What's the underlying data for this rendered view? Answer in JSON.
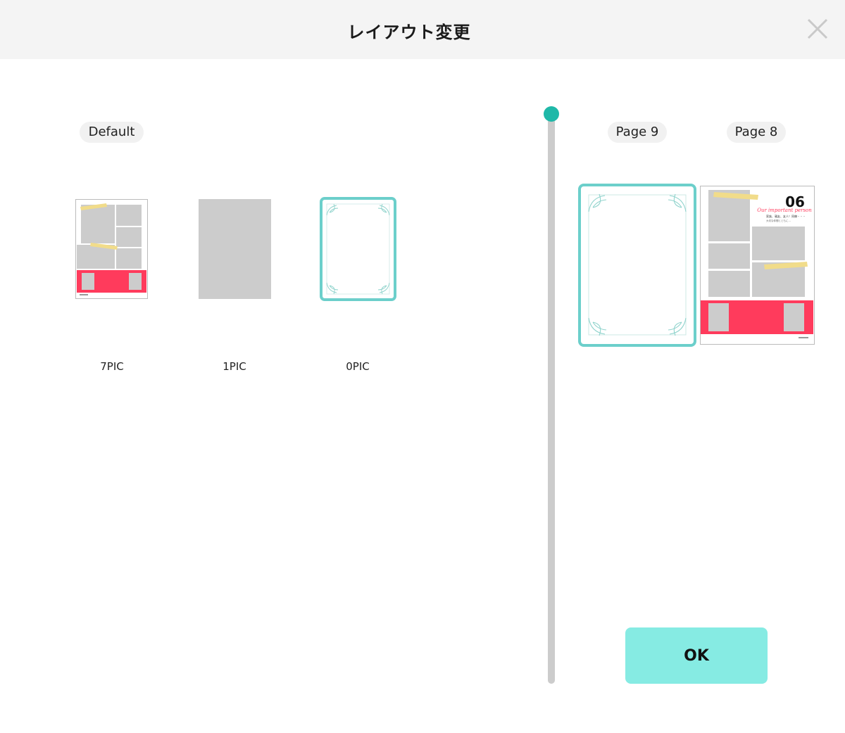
{
  "header": {
    "title": "レイアウト変更"
  },
  "layouts": {
    "group_label": "Default",
    "items": [
      {
        "label": "7PIC"
      },
      {
        "label": "1PIC"
      },
      {
        "label": "0PIC"
      }
    ]
  },
  "pages": {
    "tabs": [
      {
        "label": "Page 9"
      },
      {
        "label": "Page 8"
      }
    ],
    "page8": {
      "number": "06",
      "subtitle": "Our important person",
      "text_line1": "家族、親友、友人！同僚・・・",
      "text_line2": "大切な仲間とともに..."
    }
  },
  "footer": {
    "ok_label": "OK"
  },
  "colors": {
    "accent_teal": "#1fb8a8",
    "selection_border": "#6ccfcb",
    "ok_button": "#86ebe3",
    "red_band": "#ff3b5c",
    "photo_placeholder": "#cccccc",
    "tape": "#f1dc8a"
  }
}
